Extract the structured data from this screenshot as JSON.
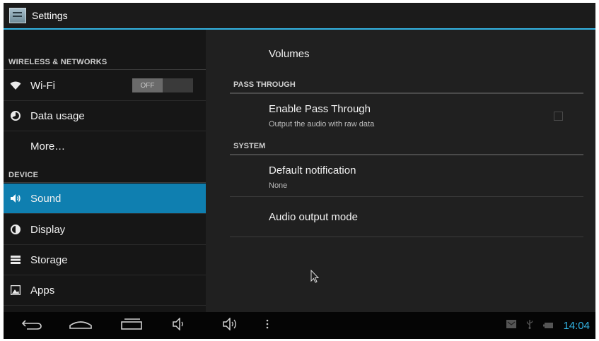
{
  "app": {
    "title": "Settings"
  },
  "sidebar": {
    "sections": [
      {
        "header": "WIRELESS & NETWORKS"
      },
      {
        "header": "DEVICE"
      }
    ],
    "items": [
      {
        "label": "Wi-Fi",
        "icon": "wifi-icon",
        "toggle": "OFF"
      },
      {
        "label": "Data usage",
        "icon": "data-usage-icon"
      },
      {
        "label": "More…",
        "icon": ""
      },
      {
        "label": "Sound",
        "icon": "sound-icon",
        "selected": true
      },
      {
        "label": "Display",
        "icon": "display-icon"
      },
      {
        "label": "Storage",
        "icon": "storage-icon"
      },
      {
        "label": "Apps",
        "icon": "apps-icon"
      }
    ]
  },
  "content": {
    "volumes": "Volumes",
    "pass_through": {
      "header": "PASS THROUGH",
      "enable_title": "Enable Pass Through",
      "enable_summary": "Output the audio with raw data",
      "checked": false
    },
    "system": {
      "header": "SYSTEM",
      "notification_title": "Default notification",
      "notification_summary": "None",
      "audio_output": "Audio output mode"
    }
  },
  "navbar": {
    "buttons": [
      "back-icon",
      "home-icon",
      "recent-apps-icon",
      "volume-down-icon",
      "volume-up-icon",
      "menu-icon"
    ],
    "status_icons": [
      "notification-icon",
      "usb-icon",
      "battery-icon"
    ],
    "time": "14:04"
  },
  "colors": {
    "accent": "#33b5e5",
    "selected": "#0f7fb0"
  }
}
